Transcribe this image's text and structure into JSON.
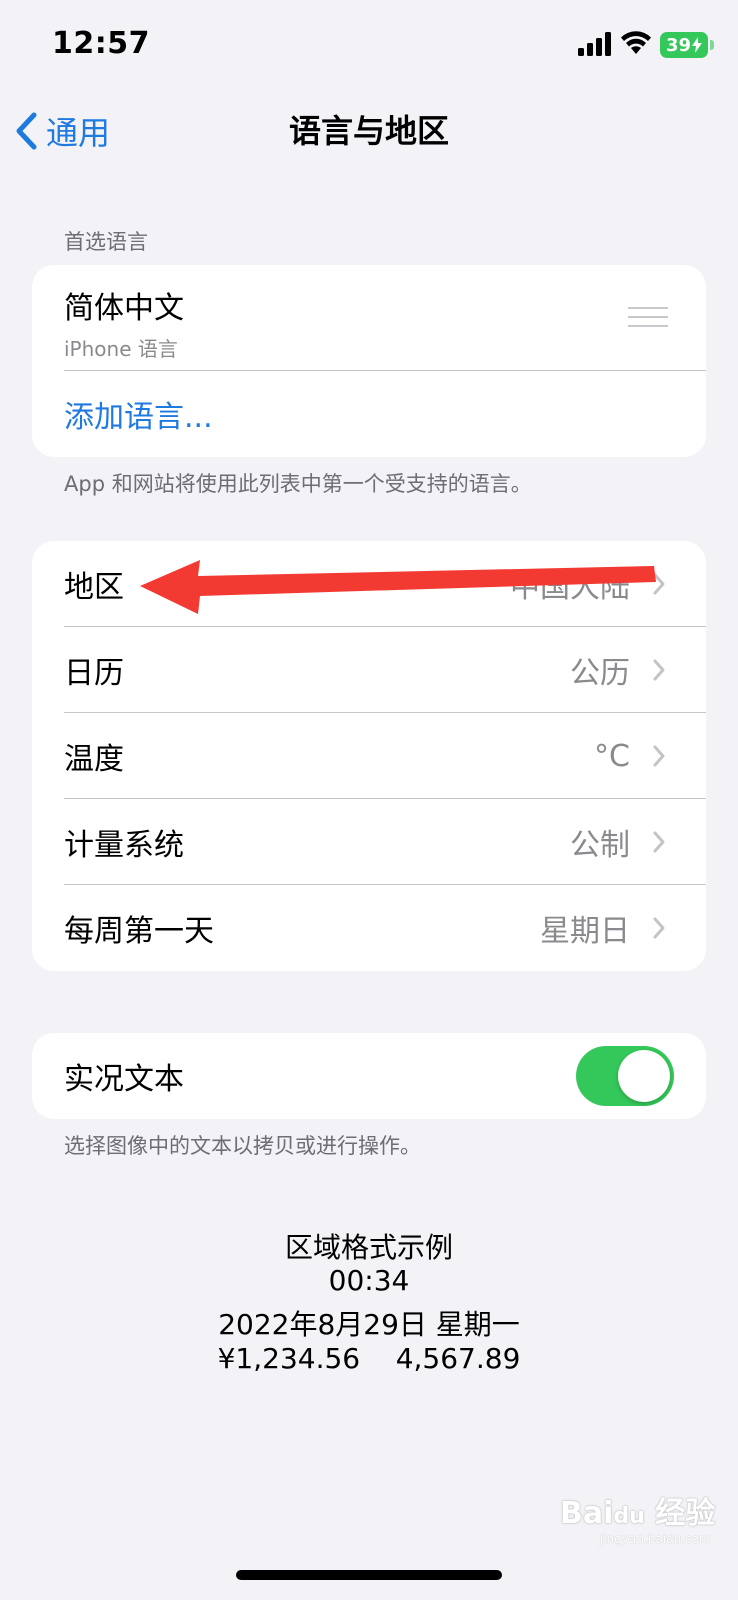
{
  "status": {
    "time": "12:57",
    "battery": "39"
  },
  "nav": {
    "back_label": "通用",
    "title": "语言与地区"
  },
  "preferred": {
    "header": "首选语言",
    "language_name": "简体中文",
    "language_sub": "iPhone 语言",
    "add_label": "添加语言...",
    "footer": "App 和网站将使用此列表中第一个受支持的语言。"
  },
  "settings": [
    {
      "label": "地区",
      "value": "中国大陆"
    },
    {
      "label": "日历",
      "value": "公历"
    },
    {
      "label": "温度",
      "value": "°C"
    },
    {
      "label": "计量系统",
      "value": "公制"
    },
    {
      "label": "每周第一天",
      "value": "星期日"
    }
  ],
  "live_text": {
    "label": "实况文本",
    "enabled": true,
    "footer": "选择图像中的文本以拷贝或进行操作。"
  },
  "example": {
    "title": "区域格式示例",
    "time": "00:34",
    "date": "2022年8月29日 星期一",
    "numbers": "¥1,234.56    4,567.89"
  },
  "watermark": {
    "brand": "Bai du 经验",
    "sub": "jingyan.baidu.com"
  },
  "colors": {
    "accent": "#1f7ae0",
    "toggle_on": "#34c759",
    "arrow": "#f23a32"
  }
}
